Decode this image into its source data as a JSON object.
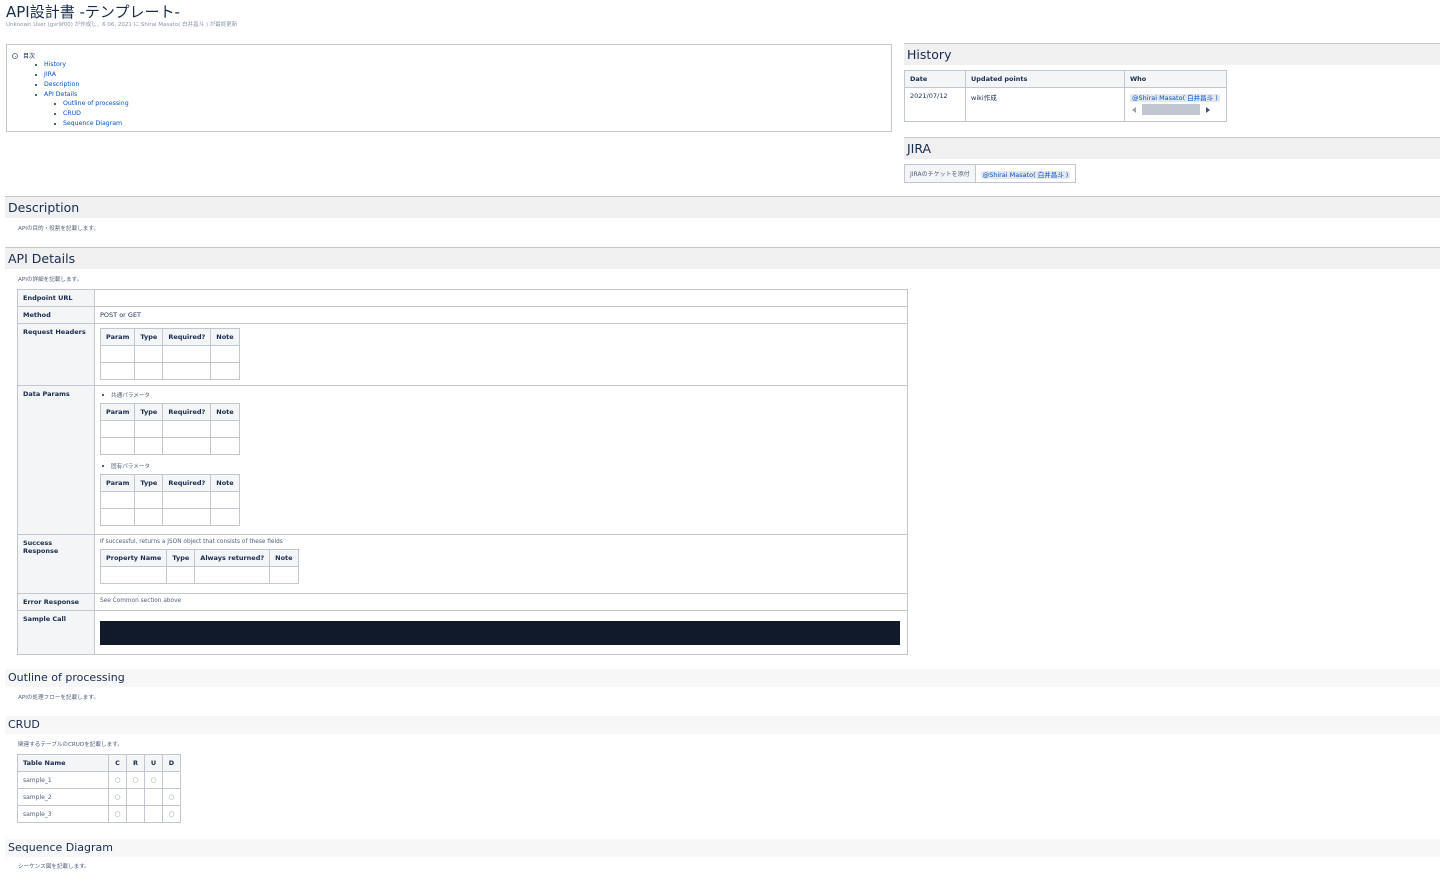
{
  "page": {
    "title": "API設計書 -テンプレート-",
    "byline": "Unknown User (gsr9f00) が作成し、6 06, 2021 に Shirai Masato( 白井昌斗 ) が最終更新"
  },
  "toc": {
    "heading": "目次",
    "items": [
      "History",
      "JIRA",
      "Description",
      "API Details",
      "Outline of processing",
      "CRUD",
      "Sequence Diagram"
    ]
  },
  "history": {
    "heading": "History",
    "headers": [
      "Date",
      "Updated points",
      "Who"
    ],
    "rows": [
      {
        "date": "2021/07/12",
        "points": "wiki作成",
        "who": "@Shirai Masato( 白井昌斗 )"
      }
    ]
  },
  "jira": {
    "heading": "JIRA",
    "label": "JIRAのチケットを添付",
    "mention": "@Shirai Masato( 白井昌斗 )"
  },
  "description": {
    "heading": "Description",
    "text": "APIの目的・役割を記載します。"
  },
  "api_details": {
    "heading": "API Details",
    "intro": "APIの詳細を記載します。",
    "rows": {
      "endpoint": "Endpoint URL",
      "method": "Method",
      "method_value": "POST or GET",
      "request_headers": "Request Headers",
      "data_params": "Data Params",
      "success_response": "Success Response",
      "success_text": "If successful, returns a JSON object that consists of these fields",
      "error_response": "Error Response",
      "error_text": "See Common section above",
      "sample_call": "Sample Call"
    },
    "param_headers": [
      "Param",
      "Type",
      "Required?",
      "Note"
    ],
    "common_params": "共通パラメータ",
    "specific_params": "固有パラメータ",
    "response_headers": [
      "Property Name",
      "Type",
      "Always returned?",
      "Note"
    ]
  },
  "outline": {
    "heading": "Outline of processing",
    "text": "APIの処理フローを記載します。"
  },
  "crud": {
    "heading": "CRUD",
    "text": "関連するテーブルのCRUDを記載します。",
    "headers": [
      "Table Name",
      "C",
      "R",
      "U",
      "D"
    ],
    "rows": [
      {
        "name": "sample_1",
        "c": "○",
        "r": "○",
        "u": "○",
        "d": ""
      },
      {
        "name": "sample_2",
        "c": "○",
        "r": "",
        "u": "",
        "d": "○"
      },
      {
        "name": "sample_3",
        "c": "○",
        "r": "",
        "u": "",
        "d": "○"
      }
    ]
  },
  "sequence": {
    "heading": "Sequence Diagram",
    "text": "シーケンス図を記載します。"
  },
  "colors": {
    "link": "#0052cc",
    "code_bg": "#111a2b",
    "heading_bg": "#f0f0f0"
  }
}
